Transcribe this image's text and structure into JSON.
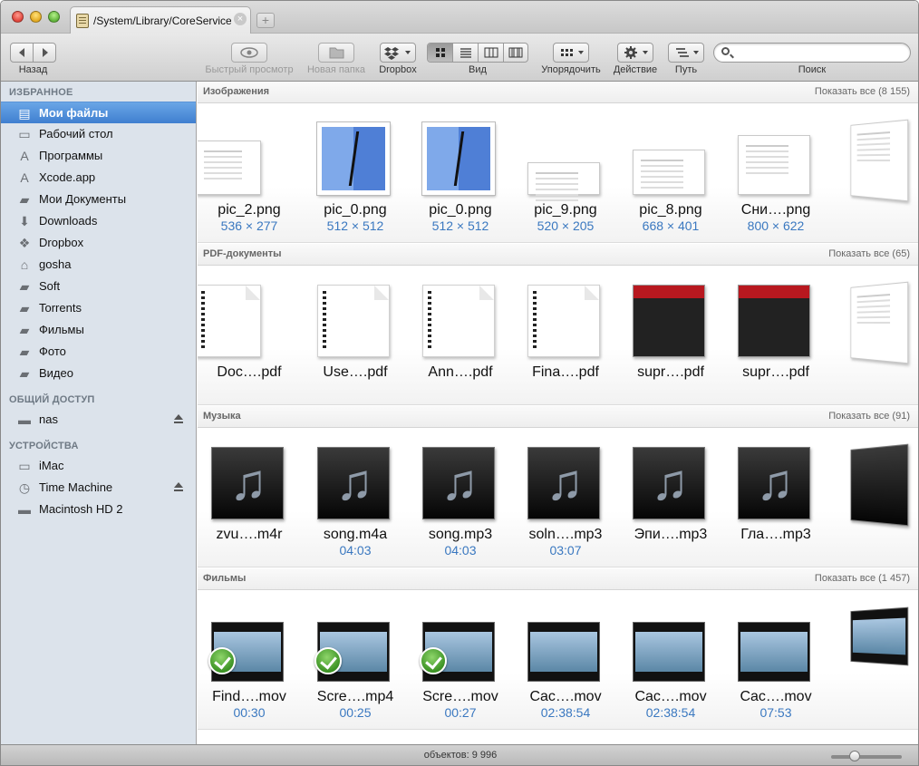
{
  "window": {
    "tab_title": "/System/Library/CoreServices",
    "tab_close_glyph": "×",
    "tab_add_glyph": "+"
  },
  "toolbar": {
    "back_label": "Назад",
    "quicklook_label": "Быстрый просмотр",
    "new_folder_label": "Новая папка",
    "dropbox_label": "Dropbox",
    "view_label": "Вид",
    "arrange_label": "Упорядочить",
    "action_label": "Действие",
    "path_label": "Путь",
    "search_label": "Поиск",
    "search_placeholder": ""
  },
  "sidebar": {
    "favorites_header": "ИЗБРАННОЕ",
    "shared_header": "ОБЩИЙ ДОСТУП",
    "devices_header": "УСТРОЙСТВА",
    "favorites": [
      {
        "label": "Мои файлы",
        "icon": "all-my-files-icon"
      },
      {
        "label": "Рабочий стол",
        "icon": "desktop-icon"
      },
      {
        "label": "Программы",
        "icon": "applications-icon"
      },
      {
        "label": "Xcode.app",
        "icon": "app-icon"
      },
      {
        "label": "Мои Документы",
        "icon": "folder-icon"
      },
      {
        "label": "Downloads",
        "icon": "downloads-icon"
      },
      {
        "label": "Dropbox",
        "icon": "dropbox-icon"
      },
      {
        "label": "gosha",
        "icon": "home-icon"
      },
      {
        "label": "Soft",
        "icon": "folder-icon"
      },
      {
        "label": "Torrents",
        "icon": "folder-icon"
      },
      {
        "label": "Фильмы",
        "icon": "folder-icon"
      },
      {
        "label": "Фото",
        "icon": "folder-icon"
      },
      {
        "label": "Видео",
        "icon": "folder-icon"
      }
    ],
    "shared": [
      {
        "label": "nas",
        "icon": "server-icon"
      }
    ],
    "devices": [
      {
        "label": "iMac",
        "icon": "imac-icon"
      },
      {
        "label": "Time Machine",
        "icon": "time-machine-icon"
      },
      {
        "label": "Macintosh HD 2",
        "icon": "disk-icon"
      }
    ]
  },
  "sections": [
    {
      "title": "Изображения",
      "show_all": "Показать все (8 155)",
      "items": [
        {
          "name": "pic_2.png",
          "sub": "536 × 277"
        },
        {
          "name": "pic_0.png",
          "sub": "512 × 512"
        },
        {
          "name": "pic_0.png",
          "sub": "512 × 512"
        },
        {
          "name": "pic_9.png",
          "sub": "520 × 205"
        },
        {
          "name": "pic_8.png",
          "sub": "668 × 401"
        },
        {
          "name": "Сни….png",
          "sub": "800 × 622"
        }
      ]
    },
    {
      "title": "PDF-документы",
      "show_all": "Показать все (65)",
      "items": [
        {
          "name": "Doc….pdf"
        },
        {
          "name": "Use….pdf"
        },
        {
          "name": "Ann….pdf"
        },
        {
          "name": "Fina….pdf"
        },
        {
          "name": "supr….pdf"
        },
        {
          "name": "supr….pdf"
        }
      ]
    },
    {
      "title": "Музыка",
      "show_all": "Показать все (91)",
      "items": [
        {
          "name": "zvu….m4r",
          "sub": ""
        },
        {
          "name": "song.m4a",
          "sub": "04:03"
        },
        {
          "name": "song.mp3",
          "sub": "04:03"
        },
        {
          "name": "soln….mp3",
          "sub": "03:07"
        },
        {
          "name": "Эпи….mp3",
          "sub": ""
        },
        {
          "name": "Гла….mp3",
          "sub": ""
        }
      ]
    },
    {
      "title": "Фильмы",
      "show_all": "Показать все (1 457)",
      "items": [
        {
          "name": "Find….mov",
          "sub": "00:30"
        },
        {
          "name": "Scre….mp4",
          "sub": "00:25"
        },
        {
          "name": "Scre….mov",
          "sub": "00:27"
        },
        {
          "name": "Cac….mov",
          "sub": "02:38:54"
        },
        {
          "name": "Cac….mov",
          "sub": "02:38:54"
        },
        {
          "name": "Cac….mov",
          "sub": "07:53"
        }
      ]
    }
  ],
  "status": {
    "items_text": "объектов: 9 996",
    "icon_size_fraction": 0.3
  },
  "colors": {
    "selection": "#3f7fd0",
    "sidebar_bg": "#dce3eb",
    "link_blue": "#3a78c0"
  }
}
